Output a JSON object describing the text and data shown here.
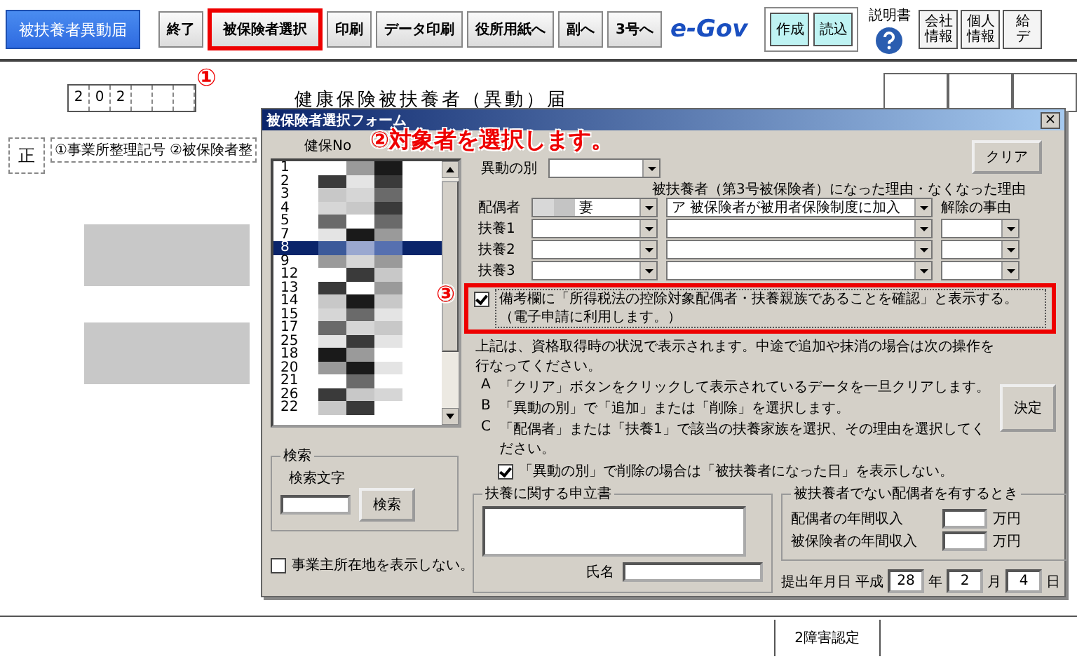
{
  "toolbar": {
    "app_button": "被扶養者異動届",
    "buttons": [
      {
        "label": "終了",
        "highlighted": false
      },
      {
        "label": "被保険者選択",
        "highlighted": true
      },
      {
        "label": "印刷",
        "highlighted": false
      },
      {
        "label": "データ印刷",
        "highlighted": false
      },
      {
        "label": "役所用紙へ",
        "highlighted": false
      },
      {
        "label": "副へ",
        "highlighted": false
      },
      {
        "label": "3号へ",
        "highlighted": false
      }
    ],
    "logo": "e-Gov",
    "data_buttons": [
      "作成",
      "読込"
    ],
    "manual": "説明書",
    "info_buttons": [
      {
        "lines": [
          "会社",
          "情報"
        ]
      },
      {
        "lines": [
          "個人",
          "情報"
        ]
      },
      {
        "lines": [
          "給",
          "デ"
        ]
      }
    ]
  },
  "form": {
    "title": "健康保険被扶養者（異動）届",
    "code_digits": [
      "2",
      "0",
      "2"
    ],
    "seal": "正",
    "col_1": "①事業所整理記号",
    "col_2": "②被保険者整",
    "footer": "2障害認定"
  },
  "dialog": {
    "title": "被保険者選択フォーム",
    "close": "×",
    "list_header": "健保No",
    "list": [
      {
        "no": "1",
        "selected": false
      },
      {
        "no": "2",
        "selected": false
      },
      {
        "no": "3",
        "selected": false
      },
      {
        "no": "4",
        "selected": false
      },
      {
        "no": "5",
        "selected": false
      },
      {
        "no": "7",
        "selected": false
      },
      {
        "no": "8",
        "selected": true
      },
      {
        "no": "9",
        "selected": false
      },
      {
        "no": "12",
        "selected": false
      },
      {
        "no": "13",
        "selected": false
      },
      {
        "no": "14",
        "selected": false
      },
      {
        "no": "15",
        "selected": false
      },
      {
        "no": "17",
        "selected": false
      },
      {
        "no": "25",
        "selected": false
      },
      {
        "no": "18",
        "selected": false
      },
      {
        "no": "20",
        "selected": false
      },
      {
        "no": "21",
        "selected": false
      },
      {
        "no": "26",
        "selected": false
      },
      {
        "no": "22",
        "selected": false
      }
    ],
    "move_label": "異動の別",
    "reason_header": "被扶養者（第3号被保険者）になった理由・なくなった理由",
    "clear_button": "クリア",
    "release_header": "解除の事由",
    "rows": [
      {
        "label": "配偶者",
        "name": "妻",
        "reason": "ア 被保険者が被用者保険制度に加入"
      },
      {
        "label": "扶養1"
      },
      {
        "label": "扶養2"
      },
      {
        "label": "扶養3"
      }
    ],
    "remarks_check": {
      "label": "備考欄に「所得税法の控除対象配偶者・扶養親族であることを確認」と表示する。（電子申請に利用します。）",
      "checked": true
    },
    "notes": "上記は、資格取得時の状況で表示されます。中途で追加や抹消の場合は次の操作を行なってください。",
    "steps": [
      {
        "letter": "A",
        "text": "「クリア」ボタンをクリックして表示されているデータを一旦クリアします。"
      },
      {
        "letter": "B",
        "text": "「異動の別」で「追加」または「削除」を選択します。"
      },
      {
        "letter": "C",
        "text": "「配偶者」または「扶養1」で該当の扶養家族を選択、その理由を選択してください。"
      }
    ],
    "delete_check": {
      "label": "「異動の別」で削除の場合は「被扶養者になった日」を表示しない。",
      "checked": true
    },
    "decide_button": "決定",
    "search": {
      "title": "検索",
      "label": "検索文字",
      "button": "検索"
    },
    "address_check": {
      "label": "事業主所在地を表示しない。",
      "checked": false
    },
    "statement": {
      "title": "扶養に関する申立書",
      "name_label": "氏名"
    },
    "spouse_income": {
      "title": "被扶養者でない配偶者を有するとき",
      "rows": [
        {
          "label": "配偶者の年間収入",
          "unit": "万円"
        },
        {
          "label": "被保険者の年間収入",
          "unit": "万円"
        }
      ]
    },
    "date": {
      "label": "提出年月日",
      "era": "平成",
      "year": "28",
      "year_unit": "年",
      "month": "2",
      "month_unit": "月",
      "day": "4",
      "day_unit": "日"
    }
  },
  "callouts": [
    {
      "number": "①"
    },
    {
      "number": "②",
      "text": "対象者を選択します。"
    },
    {
      "number": "③"
    }
  ]
}
